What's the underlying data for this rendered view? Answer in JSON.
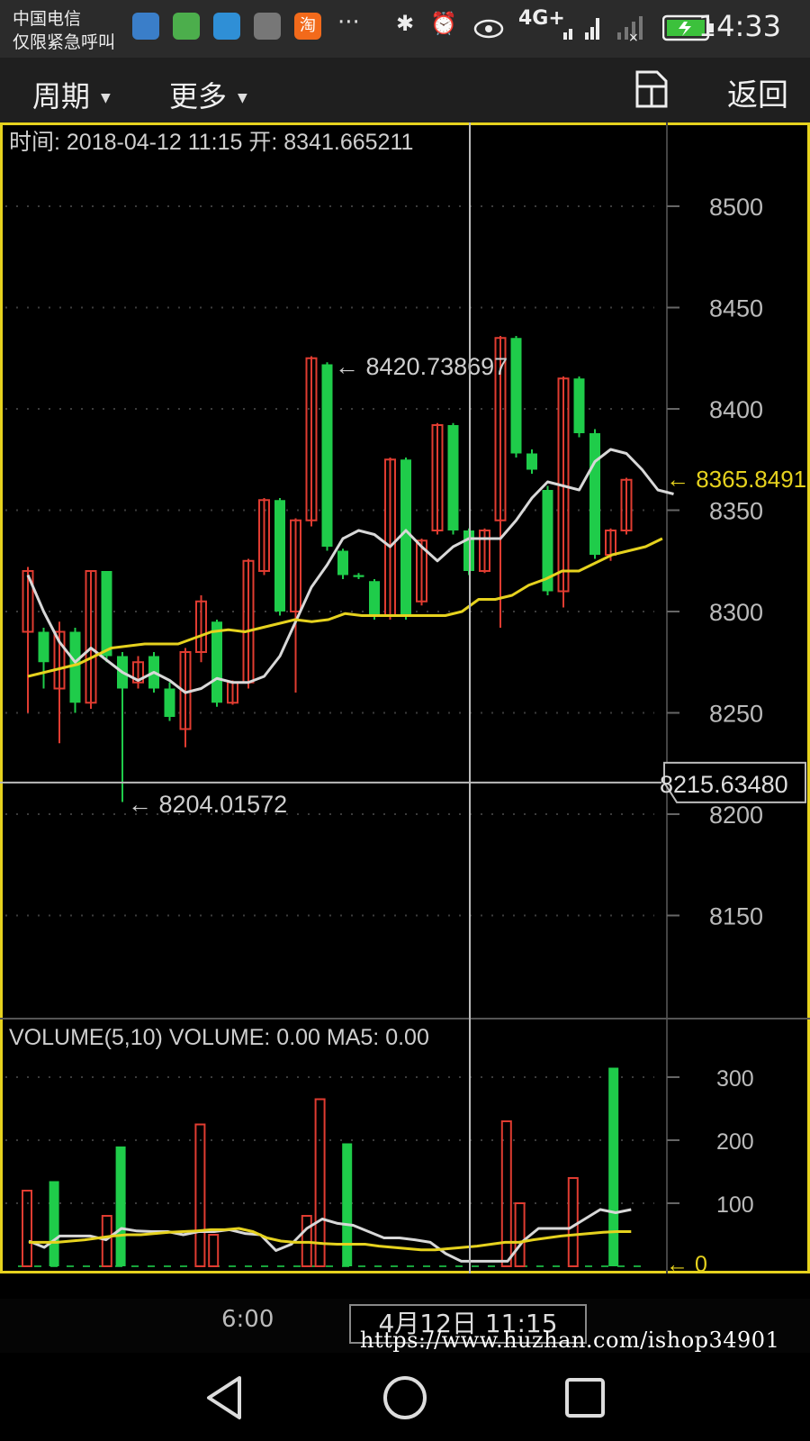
{
  "status_bar": {
    "carrier_line1": "中国电信",
    "carrier_line2": "仅限紧急呼叫",
    "app_icons": [
      "browser-icon",
      "game-icon",
      "health-icon",
      "gallery-icon",
      "taobao-icon"
    ],
    "taobao_glyph": "淘",
    "more": "···",
    "bluetooth": "✱",
    "alarm": "⏰",
    "network": "4G+",
    "time": "14:33"
  },
  "toolbar": {
    "period_label": "周期",
    "more_label": "更多",
    "caret": "▼",
    "back_label": "返回"
  },
  "colors": {
    "up": "#e03c31",
    "down": "#1fcc4a",
    "ma_short": "#d8d8d8",
    "ma_long": "#e6d21e",
    "frame": "#e6d21e",
    "grid": "#3c3c3c"
  },
  "chart": {
    "info_text": "时间: 2018-04-12  11:15  开: 8341.665211",
    "max_annotation": "← 8420.738697",
    "min_annotation": "← 8204.01572",
    "last_price_label": "← 8365.8491",
    "cursor_price_label": "8215.63480",
    "price_ticks": [
      "8500",
      "8450",
      "8400",
      "8350",
      "8300",
      "8250",
      "8200",
      "8150"
    ],
    "volume_info": "VOLUME(5,10)  VOLUME: 0.00  MA5: 0.00",
    "volume_ticks": [
      "300",
      "200",
      "100"
    ],
    "volume_zero_label": "← 0",
    "x_tick": "6:00",
    "cursor_time_label": "4月12日  11:15"
  },
  "chart_data": {
    "type": "candlestick",
    "y_range": [
      8125,
      8530
    ],
    "volume_range": [
      0,
      330
    ],
    "candles": [
      {
        "o": 8290,
        "c": 8320,
        "h": 8322,
        "l": 8250
      },
      {
        "o": 8290,
        "c": 8275,
        "h": 8292,
        "l": 8262
      },
      {
        "o": 8262,
        "c": 8290,
        "h": 8295,
        "l": 8235
      },
      {
        "o": 8290,
        "c": 8255,
        "h": 8292,
        "l": 8250
      },
      {
        "o": 8255,
        "c": 8320,
        "h": 8320,
        "l": 8252
      },
      {
        "o": 8320,
        "c": 8278,
        "h": 8320,
        "l": 8275
      },
      {
        "o": 8278,
        "c": 8262,
        "h": 8280,
        "l": 8206
      },
      {
        "o": 8265,
        "c": 8275,
        "h": 8278,
        "l": 8262
      },
      {
        "o": 8278,
        "c": 8262,
        "h": 8280,
        "l": 8260
      },
      {
        "o": 8262,
        "c": 8248,
        "h": 8265,
        "l": 8246
      },
      {
        "o": 8242,
        "c": 8280,
        "h": 8282,
        "l": 8233
      },
      {
        "o": 8280,
        "c": 8305,
        "h": 8308,
        "l": 8275
      },
      {
        "o": 8295,
        "c": 8255,
        "h": 8296,
        "l": 8253
      },
      {
        "o": 8255,
        "c": 8265,
        "h": 8266,
        "l": 8254
      },
      {
        "o": 8265,
        "c": 8325,
        "h": 8326,
        "l": 8262
      },
      {
        "o": 8320,
        "c": 8355,
        "h": 8356,
        "l": 8318
      },
      {
        "o": 8355,
        "c": 8300,
        "h": 8356,
        "l": 8298
      },
      {
        "o": 8300,
        "c": 8345,
        "h": 8346,
        "l": 8260
      },
      {
        "o": 8345,
        "c": 8425,
        "h": 8426,
        "l": 8342
      },
      {
        "o": 8422,
        "c": 8332,
        "h": 8423,
        "l": 8330
      },
      {
        "o": 8330,
        "c": 8318,
        "h": 8331,
        "l": 8316
      },
      {
        "o": 8318,
        "c": 8317,
        "h": 8319,
        "l": 8316
      },
      {
        "o": 8315,
        "c": 8298,
        "h": 8316,
        "l": 8296
      },
      {
        "o": 8298,
        "c": 8375,
        "h": 8376,
        "l": 8296
      },
      {
        "o": 8375,
        "c": 8298,
        "h": 8376,
        "l": 8296
      },
      {
        "o": 8305,
        "c": 8335,
        "h": 8336,
        "l": 8303
      },
      {
        "o": 8340,
        "c": 8392,
        "h": 8393,
        "l": 8338
      },
      {
        "o": 8392,
        "c": 8340,
        "h": 8393,
        "l": 8338
      },
      {
        "o": 8340,
        "c": 8320,
        "h": 8341,
        "l": 8318
      },
      {
        "o": 8320,
        "c": 8340,
        "h": 8341,
        "l": 8319
      },
      {
        "o": 8345,
        "c": 8435,
        "h": 8436,
        "l": 8292
      },
      {
        "o": 8435,
        "c": 8378,
        "h": 8436,
        "l": 8376
      },
      {
        "o": 8378,
        "c": 8370,
        "h": 8380,
        "l": 8368
      },
      {
        "o": 8360,
        "c": 8310,
        "h": 8362,
        "l": 8308
      },
      {
        "o": 8310,
        "c": 8415,
        "h": 8416,
        "l": 8302
      },
      {
        "o": 8415,
        "c": 8388,
        "h": 8416,
        "l": 8386
      },
      {
        "o": 8388,
        "c": 8328,
        "h": 8390,
        "l": 8326
      },
      {
        "o": 8328,
        "c": 8340,
        "h": 8341,
        "l": 8325
      },
      {
        "o": 8340,
        "c": 8365,
        "h": 8366,
        "l": 8338
      }
    ],
    "volumes": [
      120,
      0,
      135,
      0,
      0,
      0,
      80,
      190,
      0,
      0,
      0,
      0,
      0,
      225,
      50,
      0,
      0,
      0,
      0,
      0,
      0,
      80,
      265,
      0,
      195,
      0,
      0,
      0,
      0,
      0,
      0,
      0,
      0,
      0,
      0,
      0,
      230,
      100,
      0,
      0,
      0,
      140,
      0,
      0,
      315,
      0,
      0
    ],
    "ma_short": [
      8318,
      8300,
      8285,
      8275,
      8282,
      8276,
      8270,
      8266,
      8270,
      8266,
      8260,
      8262,
      8267,
      8265,
      8265,
      8268,
      8278,
      8295,
      8312,
      8323,
      8336,
      8340,
      8338,
      8332,
      8340,
      8332,
      8325,
      8332,
      8336,
      8336,
      8336,
      8345,
      8356,
      8364,
      8362,
      8360,
      8374,
      8380,
      8378,
      8370,
      8360,
      8358
    ],
    "ma_long": [
      8268,
      8270,
      8272,
      8274,
      8278,
      8282,
      8283,
      8284,
      8284,
      8284,
      8287,
      8290,
      8291,
      8290,
      8292,
      8294,
      8296,
      8295,
      8296,
      8299,
      8298,
      8298,
      8298,
      8298,
      8298,
      8298,
      8300,
      8306,
      8306,
      8308,
      8313,
      8316,
      8320,
      8320,
      8324,
      8328,
      8330,
      8332,
      8336
    ],
    "vol_ma5": [
      40,
      30,
      48,
      48,
      48,
      42,
      60,
      56,
      55,
      55,
      50,
      55,
      55,
      58,
      52,
      50,
      25,
      35,
      60,
      75,
      68,
      65,
      55,
      45,
      45,
      42,
      38,
      20,
      8,
      8,
      8,
      8,
      40,
      60,
      60,
      60,
      75,
      90,
      85,
      90
    ],
    "vol_ma10": [
      38,
      38,
      38,
      40,
      42,
      45,
      48,
      50,
      50,
      52,
      54,
      55,
      56,
      58,
      58,
      60,
      55,
      45,
      40,
      38,
      38,
      36,
      35,
      35,
      35,
      32,
      30,
      28,
      26,
      26,
      28,
      30,
      32,
      35,
      38,
      38,
      42,
      45,
      48,
      50,
      52,
      54,
      55,
      55
    ]
  },
  "xaxis": {
    "tick_6": "6:00"
  },
  "watermark": "https://www.huzhan.com/ishop34901",
  "nav_bar": [
    "back-icon",
    "home-icon",
    "recents-icon"
  ]
}
